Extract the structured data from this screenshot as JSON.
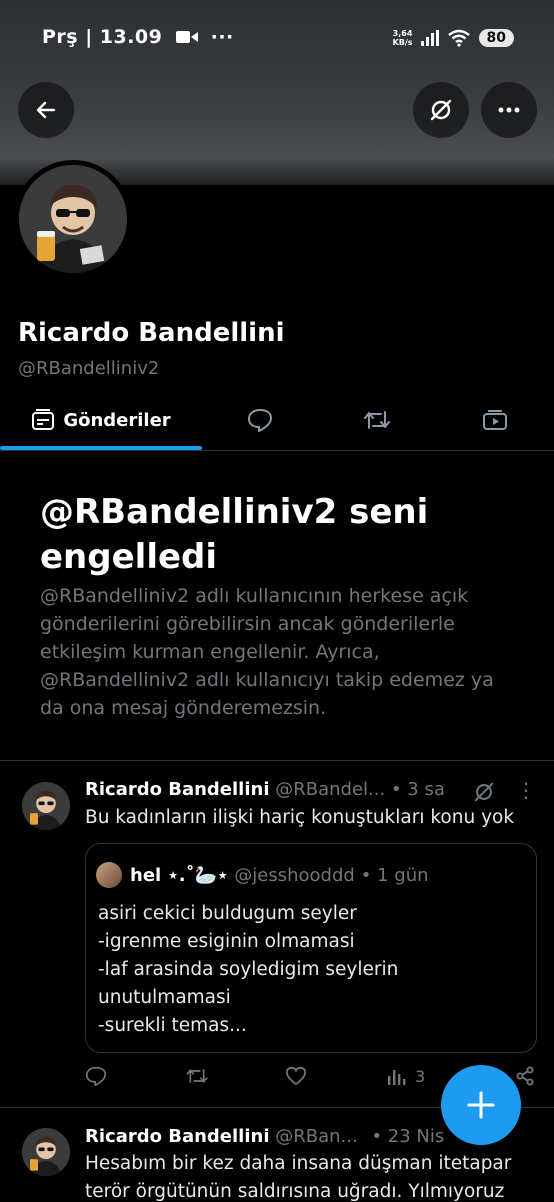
{
  "status_bar": {
    "left_text": "Prş | 13.09",
    "speed_value": "3,64",
    "speed_unit": "KB/s",
    "battery": "80"
  },
  "profile": {
    "name": "Ricardo Bandellini",
    "handle": "@RBandelliniv2"
  },
  "tabs": [
    {
      "label": "Gönderiler",
      "icon": "posts-icon",
      "active": true
    },
    {
      "label": "",
      "icon": "replies-icon"
    },
    {
      "label": "",
      "icon": "reposts-icon"
    },
    {
      "label": "",
      "icon": "media-icon"
    }
  ],
  "block_notice": {
    "title": "@RBandelliniv2 seni engelledi",
    "description": "@RBandelliniv2 adlı kullanıcının herkese açık gönderilerini görebilirsin ancak gönderilerle etkileşim kurman engellenir. Ayrıca, @RBandelliniv2 adlı kullanıcıyı takip edemez ya da ona mesaj gönderemezsin."
  },
  "posts": [
    {
      "name": "Ricardo Bandellini",
      "handle": "@RBandel...",
      "time": "• 3 sa",
      "text": "Bu kadınların ilişki hariç konuştukları konu yok",
      "quote": {
        "name": "hel ⋆.˚🦢⋆",
        "handle": "@jesshooddd",
        "time": "• 1 gün",
        "lines": [
          "asiri cekici buldugum seyler",
          "-igrenme esiginin olmamasi",
          "-laf arasinda soyledigim seylerin",
          "unutulmamasi",
          "-surekli temas..."
        ]
      },
      "views": "3"
    },
    {
      "name": "Ricardo Bandellini",
      "handle": "@RBan...",
      "time": "• 23 Nis",
      "text_lines": [
        "Hesabım bir kez daha insana düşman itetapar",
        "terör örgütünün saldırısına uğradı. Yılmıyoruz"
      ]
    }
  ],
  "colors": {
    "accent": "#1d9bf0",
    "muted": "#71767b",
    "background": "#000000"
  }
}
